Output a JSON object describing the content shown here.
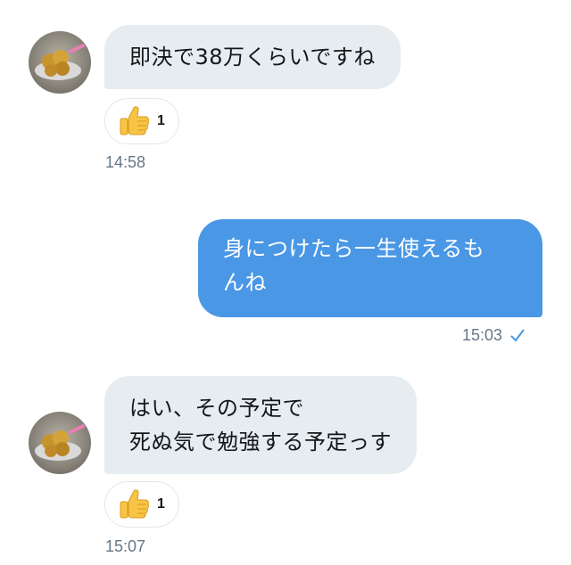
{
  "messages": [
    {
      "direction": "incoming",
      "text": "即決で38万くらいですね",
      "reaction": {
        "emoji": "thumbs-up",
        "count": "1"
      },
      "time": "14:58"
    },
    {
      "direction": "outgoing",
      "lines": [
        "身につけたら一生使えるも",
        "んね"
      ],
      "time": "15:03",
      "status": "sent-check-icon"
    },
    {
      "direction": "incoming",
      "lines": [
        "はい、その予定で",
        "死ぬ気で勉強する予定っす"
      ],
      "reaction": {
        "emoji": "thumbs-up",
        "count": "1"
      },
      "time": "15:07"
    }
  ],
  "colors": {
    "incoming_bubble": "#e6ecf0",
    "outgoing_bubble": "#4a97e6",
    "timestamp": "#657786",
    "check": "#4a97e6"
  }
}
